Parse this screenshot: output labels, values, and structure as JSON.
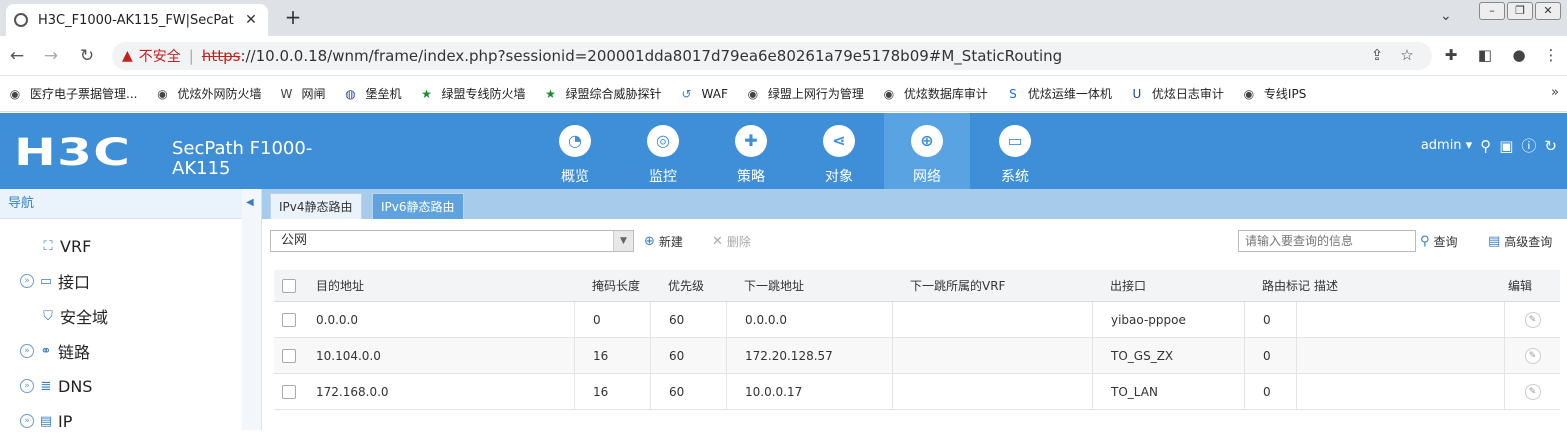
{
  "browser": {
    "tab_title": "H3C_F1000-AK115_FW|SecPat",
    "tab_close": "✕",
    "new_tab": "+",
    "not_secure": "不安全",
    "url_scheme": "https",
    "url_rest": "://10.0.0.18/wnm/frame/index.php?sessionid=200001dda8017d79ea6e80261a79e5178b09#M_StaticRouting",
    "bookmarks": [
      {
        "label": "医疗电子票据管理...",
        "icon": "globe-icon"
      },
      {
        "label": "优炫外网防火墙",
        "icon": "globe-icon"
      },
      {
        "label": "网闸",
        "icon": "w-icon"
      },
      {
        "label": "堡垒机",
        "icon": "shield-icon"
      },
      {
        "label": "绿盟专线防火墙",
        "icon": "star-icon"
      },
      {
        "label": "绿盟综合威胁探针",
        "icon": "star-icon"
      },
      {
        "label": "WAF",
        "icon": "waf-icon"
      },
      {
        "label": "绿盟上网行为管理",
        "icon": "globe-icon"
      },
      {
        "label": "优炫数据库审计",
        "icon": "globe-icon"
      },
      {
        "label": "优炫运维一体机",
        "icon": "s-icon"
      },
      {
        "label": "优炫日志审计",
        "icon": "u-icon"
      },
      {
        "label": "专线IPS",
        "icon": "globe-icon"
      }
    ]
  },
  "header": {
    "logo": "H3C",
    "model": "SecPath F1000-AK115",
    "menu": [
      {
        "label": "概览",
        "icon": "gauge-icon"
      },
      {
        "label": "监控",
        "icon": "camera-icon"
      },
      {
        "label": "策略",
        "icon": "shield-plus-icon"
      },
      {
        "label": "对象",
        "icon": "share-icon"
      },
      {
        "label": "网络",
        "icon": "globe-icon"
      },
      {
        "label": "系统",
        "icon": "monitor-icon"
      }
    ],
    "user": "admin"
  },
  "sidebar": {
    "title": "导航",
    "items": [
      {
        "label": "VRF",
        "icon": "vrf-icon",
        "expandable": false
      },
      {
        "label": "接口",
        "icon": "interface-icon",
        "expandable": true
      },
      {
        "label": "安全域",
        "icon": "security-zone-icon",
        "expandable": false
      },
      {
        "label": "链路",
        "icon": "link-icon",
        "expandable": true
      },
      {
        "label": "DNS",
        "icon": "dns-icon",
        "expandable": true
      },
      {
        "label": "IP",
        "icon": "ip-icon",
        "expandable": true
      }
    ]
  },
  "content": {
    "tabs": [
      "IPv4静态路由",
      "IPv6静态路由"
    ],
    "vrf_selected": "公网",
    "new_label": "新建",
    "delete_label": "删除",
    "search_placeholder": "请输入要查询的信息",
    "query_label": "查询",
    "advanced_query_label": "高级查询",
    "columns": [
      "目的地址",
      "掩码长度",
      "优先级",
      "下一跳地址",
      "下一跳所属的VRF",
      "出接口",
      "路由标记",
      "描述",
      "编辑"
    ],
    "rows": [
      {
        "dest": "0.0.0.0",
        "mask": "0",
        "pref": "60",
        "nexthop": "0.0.0.0",
        "nhvrf": "",
        "iface": "yibao-pppoe",
        "tag": "0",
        "desc": ""
      },
      {
        "dest": "10.104.0.0",
        "mask": "16",
        "pref": "60",
        "nexthop": "172.20.128.57",
        "nhvrf": "",
        "iface": "TO_GS_ZX",
        "tag": "0",
        "desc": ""
      },
      {
        "dest": "172.168.0.0",
        "mask": "16",
        "pref": "60",
        "nexthop": "10.0.0.17",
        "nhvrf": "",
        "iface": "TO_LAN",
        "tag": "0",
        "desc": ""
      }
    ]
  }
}
